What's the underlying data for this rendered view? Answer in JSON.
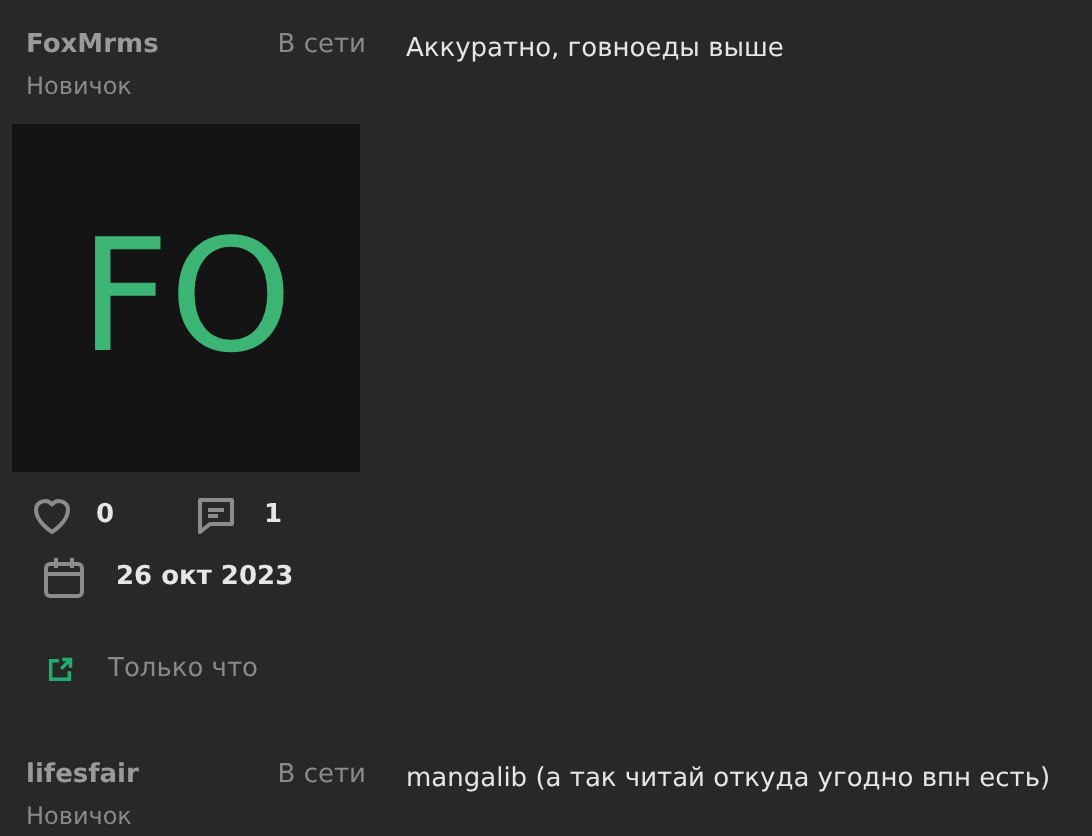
{
  "posts": [
    {
      "author": "FoxMrms",
      "status": "В сети",
      "rank": "Новичок",
      "message": "Аккуратно, говноеды выше",
      "avatar": {
        "initials": "FO",
        "color": "#3cb473"
      },
      "likes": "0",
      "comments": "1",
      "date": "26 окт 2023",
      "time": "Только что"
    },
    {
      "author": "lifesfair",
      "status": "В сети",
      "rank": "Новичок",
      "message": "mangalib (а так читай откуда угодно впн есть)"
    }
  ]
}
